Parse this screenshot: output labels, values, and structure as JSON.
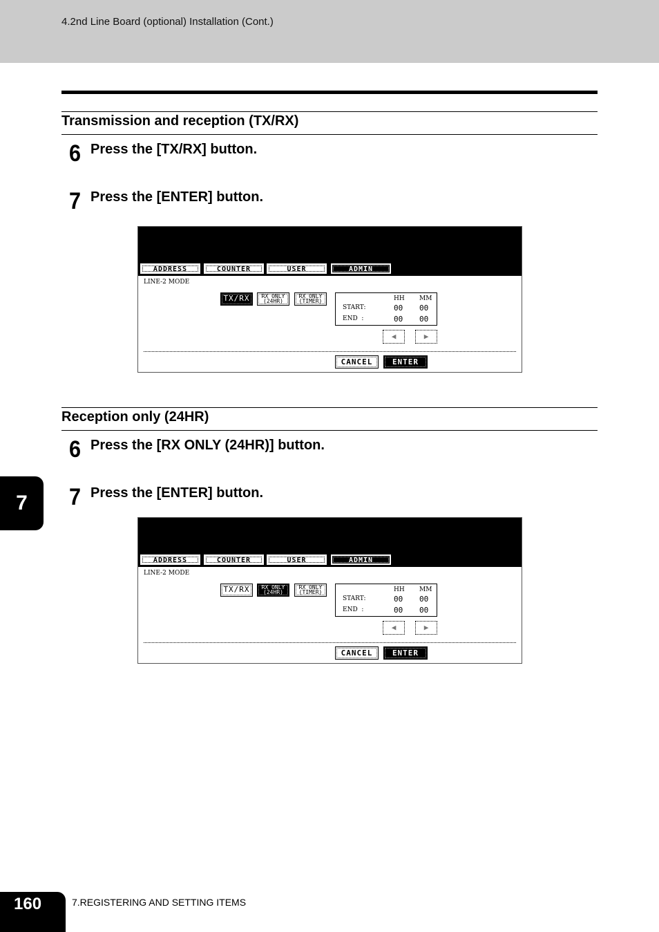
{
  "header": {
    "title": "4.2nd Line Board (optional) Installation (Cont.)"
  },
  "sections": [
    {
      "title": "Transmission and reception (TX/RX)",
      "steps": [
        {
          "num": "6",
          "text": "Press the [TX/RX] button."
        },
        {
          "num": "7",
          "text": "Press the [ENTER] button."
        }
      ],
      "panel": {
        "tabs": [
          "ADDRESS",
          "COUNTER",
          "USER",
          "ADMIN"
        ],
        "active_tab": "ADMIN",
        "mode_label": "LINE-2 MODE",
        "mode_buttons": [
          {
            "label": "TX/RX",
            "line1": "TX/RX",
            "line2": ""
          },
          {
            "label": "RX ONLY (24HR)",
            "line1": "RX ONLY",
            "line2": "(24HR)"
          },
          {
            "label": "RX ONLY (TIMER)",
            "line1": "RX ONLY",
            "line2": "(TIMER)"
          }
        ],
        "selected_mode": "TX/RX",
        "time": {
          "hh_label": "HH",
          "mm_label": "MM",
          "start_label": "START:",
          "end_label": "END  :",
          "start_hh": "00",
          "start_mm": "00",
          "end_hh": "00",
          "end_mm": "00"
        },
        "arrow_left": "◆",
        "arrow_right": "➧",
        "cancel_label": "CANCEL",
        "enter_label": "ENTER"
      }
    },
    {
      "title": "Reception only (24HR)",
      "steps": [
        {
          "num": "6",
          "text": "Press the [RX ONLY (24HR)] button."
        },
        {
          "num": "7",
          "text": "Press the [ENTER] button."
        }
      ],
      "panel": {
        "tabs": [
          "ADDRESS",
          "COUNTER",
          "USER",
          "ADMIN"
        ],
        "active_tab": "ADMIN",
        "mode_label": "LINE-2 MODE",
        "mode_buttons": [
          {
            "label": "TX/RX",
            "line1": "TX/RX",
            "line2": ""
          },
          {
            "label": "RX ONLY (24HR)",
            "line1": "RX ONLY",
            "line2": "(24HR)"
          },
          {
            "label": "RX ONLY (TIMER)",
            "line1": "RX ONLY",
            "line2": "(TIMER)"
          }
        ],
        "selected_mode": "RX ONLY (24HR)",
        "time": {
          "hh_label": "HH",
          "mm_label": "MM",
          "start_label": "START:",
          "end_label": "END  :",
          "start_hh": "00",
          "start_mm": "00",
          "end_hh": "00",
          "end_mm": "00"
        },
        "arrow_left": "◆",
        "arrow_right": "➧",
        "cancel_label": "CANCEL",
        "enter_label": "ENTER"
      }
    }
  ],
  "chapter_tab": "7",
  "footer": {
    "page_number": "160",
    "chapter_title": "7.REGISTERING AND SETTING ITEMS"
  }
}
